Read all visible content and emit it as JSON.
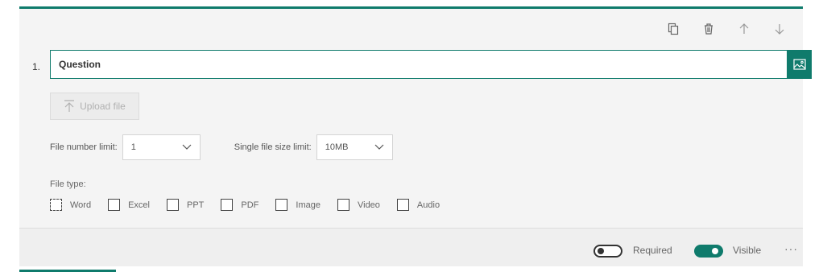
{
  "question": {
    "number": "1.",
    "title": "Question"
  },
  "toolbar": {
    "icons": [
      "copy-icon",
      "trash-icon",
      "arrow-up-icon",
      "arrow-down-icon"
    ]
  },
  "upload": {
    "label": "Upload file"
  },
  "limits": {
    "file_number_label": "File number limit:",
    "file_number_value": "1",
    "file_size_label": "Single file size limit:",
    "file_size_value": "10MB"
  },
  "file_type": {
    "label": "File type:",
    "options": [
      "Word",
      "Excel",
      "PPT",
      "PDF",
      "Image",
      "Video",
      "Audio"
    ]
  },
  "footer": {
    "required_label": "Required",
    "visible_label": "Visible",
    "more_label": "···"
  },
  "colors": {
    "accent": "#0f7b6c"
  }
}
